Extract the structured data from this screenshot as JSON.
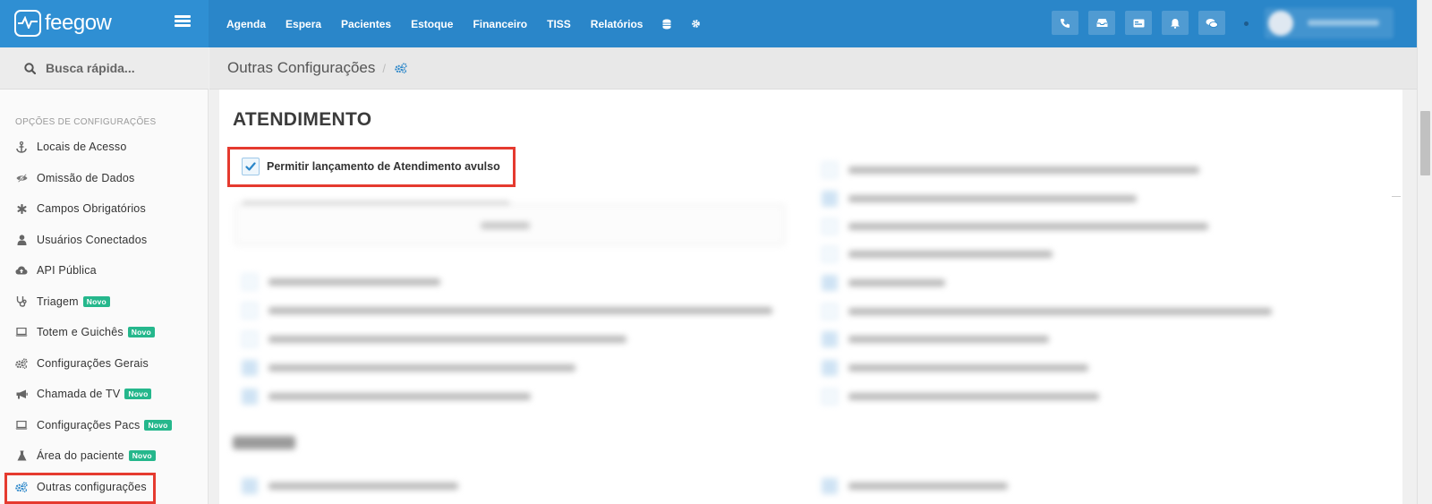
{
  "app": {
    "logo_text": "feegow"
  },
  "topnav": {
    "items": [
      {
        "label": "Agenda"
      },
      {
        "label": "Espera"
      },
      {
        "label": "Pacientes"
      },
      {
        "label": "Estoque"
      },
      {
        "label": "Financeiro"
      },
      {
        "label": "TISS"
      },
      {
        "label": "Relatórios"
      }
    ],
    "icons": [
      "database-icon",
      "gear-icon"
    ],
    "right_icons": [
      "phone-icon",
      "inbox-icon",
      "card-icon",
      "bell-icon",
      "chat-icon"
    ]
  },
  "sidebar": {
    "search_label": "Busca rápida...",
    "section_title": "OPÇÕES DE CONFIGURAÇÕES",
    "items": [
      {
        "label": "Locais de Acesso",
        "icon": "anchor-icon"
      },
      {
        "label": "Omissão de Dados",
        "icon": "eye-slash-icon"
      },
      {
        "label": "Campos Obrigatórios",
        "icon": "asterisk-icon"
      },
      {
        "label": "Usuários Conectados",
        "icon": "user-icon"
      },
      {
        "label": "API Pública",
        "icon": "cloud-upload-icon"
      },
      {
        "label": "Triagem",
        "icon": "stethoscope-icon",
        "badge": "Novo"
      },
      {
        "label": "Totem e Guichês",
        "icon": "laptop-icon",
        "badge": "Novo"
      },
      {
        "label": "Configurações Gerais",
        "icon": "cogs-icon"
      },
      {
        "label": "Chamada de TV",
        "icon": "bullhorn-icon",
        "badge": "Novo"
      },
      {
        "label": "Configurações Pacs",
        "icon": "laptop-icon",
        "badge": "Novo"
      },
      {
        "label": "Área do paciente",
        "icon": "flask-icon",
        "badge": "Novo"
      },
      {
        "label": "Outras configurações",
        "icon": "cogs-icon",
        "active": true
      }
    ]
  },
  "breadcrumb": {
    "title": "Outras Configurações",
    "separator": "/"
  },
  "main": {
    "section_title": "ATENDIMENTO",
    "option_allow_standalone": {
      "label": "Permitir lançamento de Atendimento avulso",
      "checked": true
    }
  },
  "colors": {
    "topbar": "#2a86c9",
    "highlight": "#e53a2f",
    "badge": "#25b78c"
  }
}
